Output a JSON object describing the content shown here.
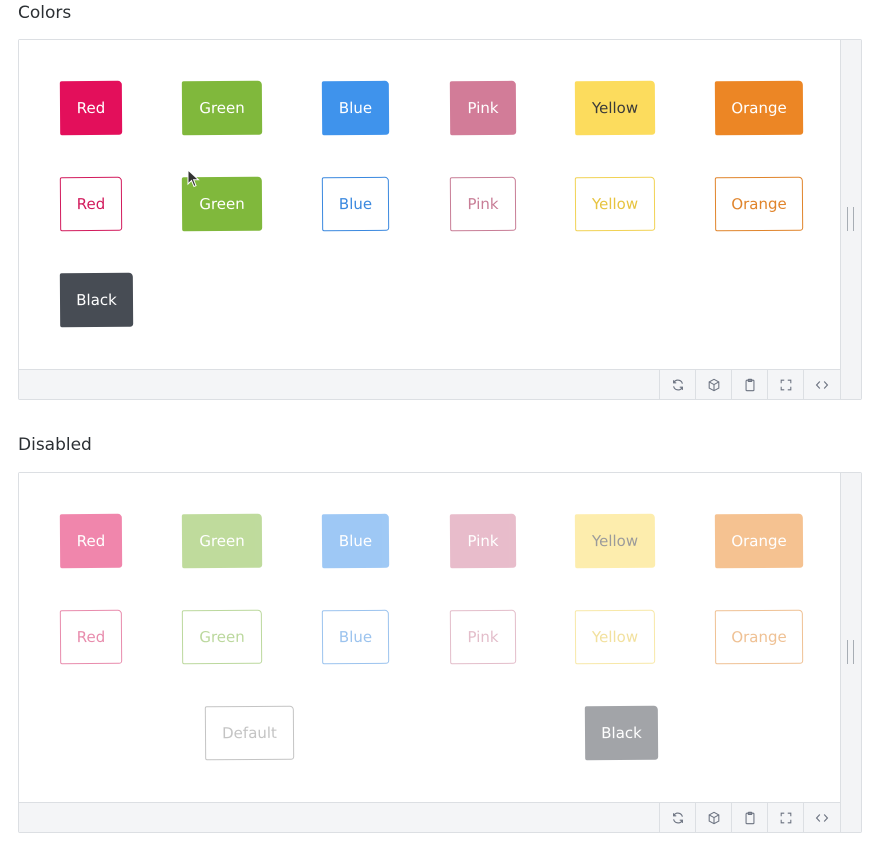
{
  "sections": [
    {
      "title": "Colors",
      "rows": [
        [
          {
            "label": "Red",
            "color": "red",
            "variant": "solid"
          },
          {
            "label": "Green",
            "color": "green",
            "variant": "solid"
          },
          {
            "label": "Blue",
            "color": "blue",
            "variant": "solid"
          },
          {
            "label": "Pink",
            "color": "pink",
            "variant": "solid"
          },
          {
            "label": "Yellow",
            "color": "yellow",
            "variant": "solid"
          },
          {
            "label": "Orange",
            "color": "orange",
            "variant": "solid"
          }
        ],
        [
          {
            "label": "Red",
            "color": "red",
            "variant": "outline"
          },
          {
            "label": "Green",
            "color": "green",
            "variant": "solid"
          },
          {
            "label": "Blue",
            "color": "blue",
            "variant": "outline"
          },
          {
            "label": "Pink",
            "color": "pink",
            "variant": "outline"
          },
          {
            "label": "Yellow",
            "color": "yellow",
            "variant": "outline"
          },
          {
            "label": "Orange",
            "color": "orange",
            "variant": "outline"
          }
        ],
        [
          {
            "label": "Black",
            "color": "black",
            "variant": "solid"
          }
        ]
      ]
    },
    {
      "title": "Disabled",
      "rows": [
        [
          {
            "label": "Red",
            "color": "red",
            "variant": "solid"
          },
          {
            "label": "Green",
            "color": "green",
            "variant": "solid"
          },
          {
            "label": "Blue",
            "color": "blue",
            "variant": "solid"
          },
          {
            "label": "Pink",
            "color": "pink",
            "variant": "solid"
          },
          {
            "label": "Yellow",
            "color": "yellow",
            "variant": "solid"
          },
          {
            "label": "Orange",
            "color": "orange",
            "variant": "solid"
          }
        ],
        [
          {
            "label": "Red",
            "color": "red",
            "variant": "outline"
          },
          {
            "label": "Green",
            "color": "green",
            "variant": "outline"
          },
          {
            "label": "Blue",
            "color": "blue",
            "variant": "outline"
          },
          {
            "label": "Pink",
            "color": "pink",
            "variant": "outline"
          },
          {
            "label": "Yellow",
            "color": "yellow",
            "variant": "outline"
          },
          {
            "label": "Orange",
            "color": "orange",
            "variant": "outline"
          }
        ],
        [
          {
            "label": "Default",
            "color": "default",
            "variant": "outline"
          },
          {
            "label": "Black",
            "color": "black",
            "variant": "solid"
          }
        ]
      ]
    }
  ],
  "toolbar_icons": [
    "refresh-icon",
    "cube-icon",
    "clipboard-icon",
    "fullscreen-icon",
    "code-icon"
  ],
  "colors": {
    "red": "#e30f5b",
    "green": "#80b83c",
    "blue": "#3f93ec",
    "pink": "#d27c98",
    "yellow": "#fcdc5d",
    "orange": "#ec8625",
    "black": "#474c54"
  }
}
